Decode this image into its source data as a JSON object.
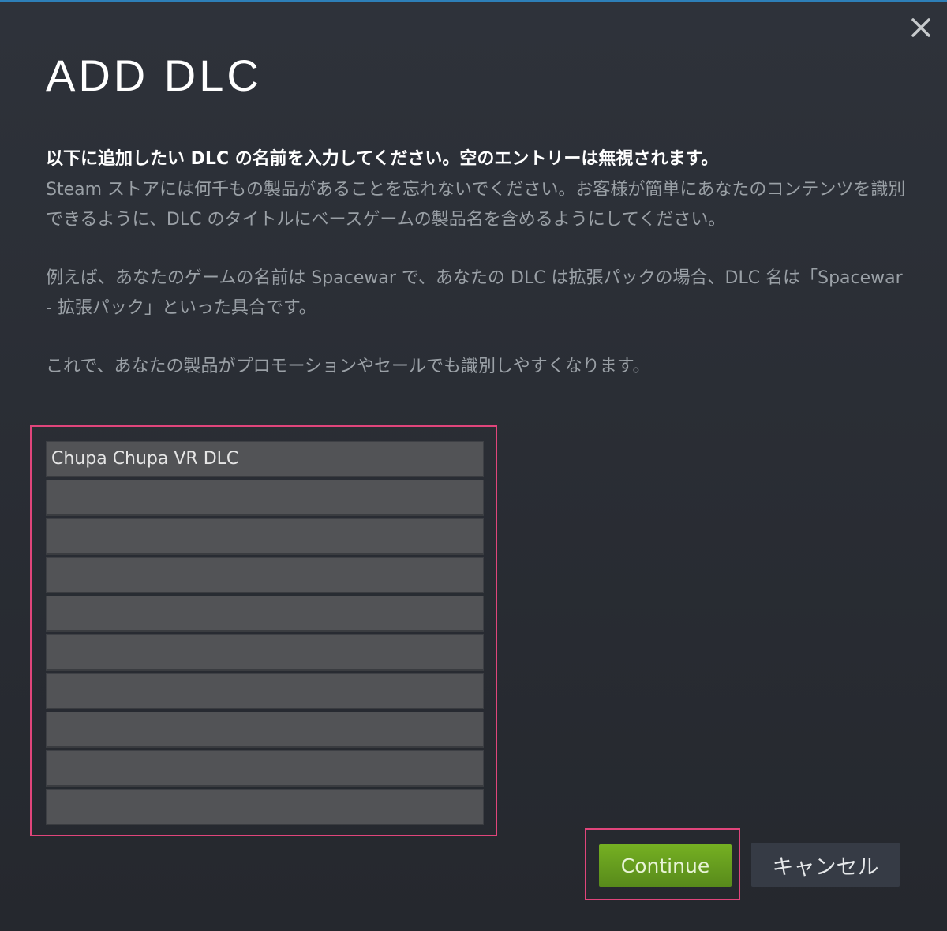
{
  "dialog": {
    "title": "ADD DLC",
    "close_icon": "close-icon",
    "instructions": {
      "lead": "以下に追加したい DLC の名前を入力してください。空のエントリーは無視されます。",
      "paragraph1": "Steam ストアには何千もの製品があることを忘れないでください。お客様が簡単にあなたのコンテンツを識別できるように、DLC のタイトルにベースゲームの製品名を含めるようにしてください。",
      "paragraph2": "例えば、あなたのゲームの名前は Spacewar で、あなたの DLC は拡張パックの場合、DLC 名は「Spacewar - 拡張パック」といった具合です。",
      "paragraph3": "これで、あなたの製品がプロモーションやセールでも識別しやすくなります。"
    },
    "entries": [
      "Chupa Chupa VR DLC",
      "",
      "",
      "",
      "",
      "",
      "",
      "",
      "",
      ""
    ],
    "buttons": {
      "continue_label": "Continue",
      "cancel_label": "キャンセル"
    },
    "colors": {
      "accent_highlight": "#e0457b",
      "continue_green": "#6ba21f",
      "top_border_blue": "#2d7fb8"
    }
  }
}
